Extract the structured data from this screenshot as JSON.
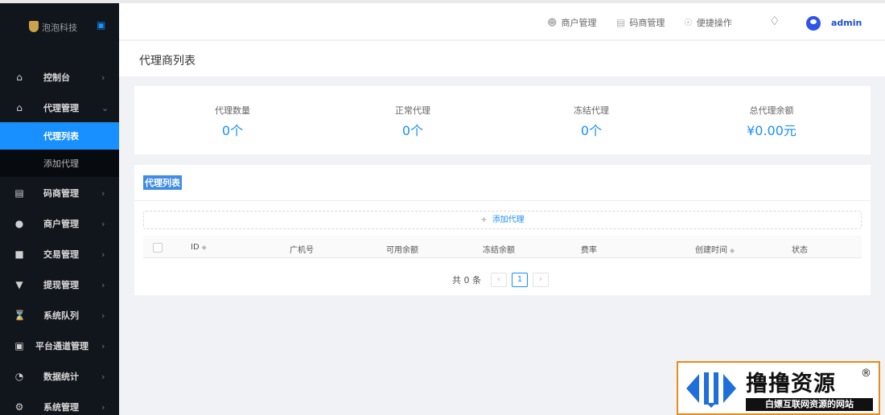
{
  "sidebar": {
    "logo_text": "泡泡科技",
    "items": [
      {
        "label": "控制台",
        "icon": "home-icon"
      },
      {
        "label": "代理管理",
        "icon": "agent-icon",
        "expanded": true
      },
      {
        "label": "码商管理",
        "icon": "store-icon"
      },
      {
        "label": "商户管理",
        "icon": "merchant-icon"
      },
      {
        "label": "交易管理",
        "icon": "trade-icon"
      },
      {
        "label": "提现管理",
        "icon": "withdraw-icon"
      },
      {
        "label": "系统队列",
        "icon": "hourglass-icon"
      },
      {
        "label": "平台通道管理",
        "icon": "channel-icon"
      },
      {
        "label": "数据统计",
        "icon": "pie-chart-icon"
      },
      {
        "label": "系统管理",
        "icon": "gear-icon"
      }
    ],
    "subitems": [
      {
        "label": "代理列表",
        "active": true
      },
      {
        "label": "添加代理",
        "active": false
      }
    ]
  },
  "header": {
    "links": [
      {
        "label": "商户管理",
        "icon": "user-icon"
      },
      {
        "label": "码商管理",
        "icon": "store-icon"
      },
      {
        "label": "便捷操作",
        "icon": "location-icon"
      }
    ],
    "user": "admin"
  },
  "page": {
    "title": "代理商列表"
  },
  "stats": [
    {
      "label": "代理数量",
      "value": "0个"
    },
    {
      "label": "正常代理",
      "value": "0个"
    },
    {
      "label": "冻结代理",
      "value": "0个"
    },
    {
      "label": "总代理余额",
      "value": "¥0.00元"
    }
  ],
  "list": {
    "title": "代理列表",
    "add_label": "添加代理",
    "columns": [
      "ID",
      "广机号",
      "可用余额",
      "冻结余额",
      "费率",
      "创建时间",
      "状态"
    ],
    "pagination": {
      "total_text": "共 0 条",
      "current_page": "1",
      "prev": "‹",
      "next": "›"
    }
  },
  "watermark": {
    "title": "撸撸资源",
    "reg": "®",
    "subtitle": "白嫖互联网资源的网站"
  },
  "colors": {
    "accent": "#1890ff",
    "sidebar_bg": "#11151c",
    "watermark_border": "#e88b1a"
  }
}
